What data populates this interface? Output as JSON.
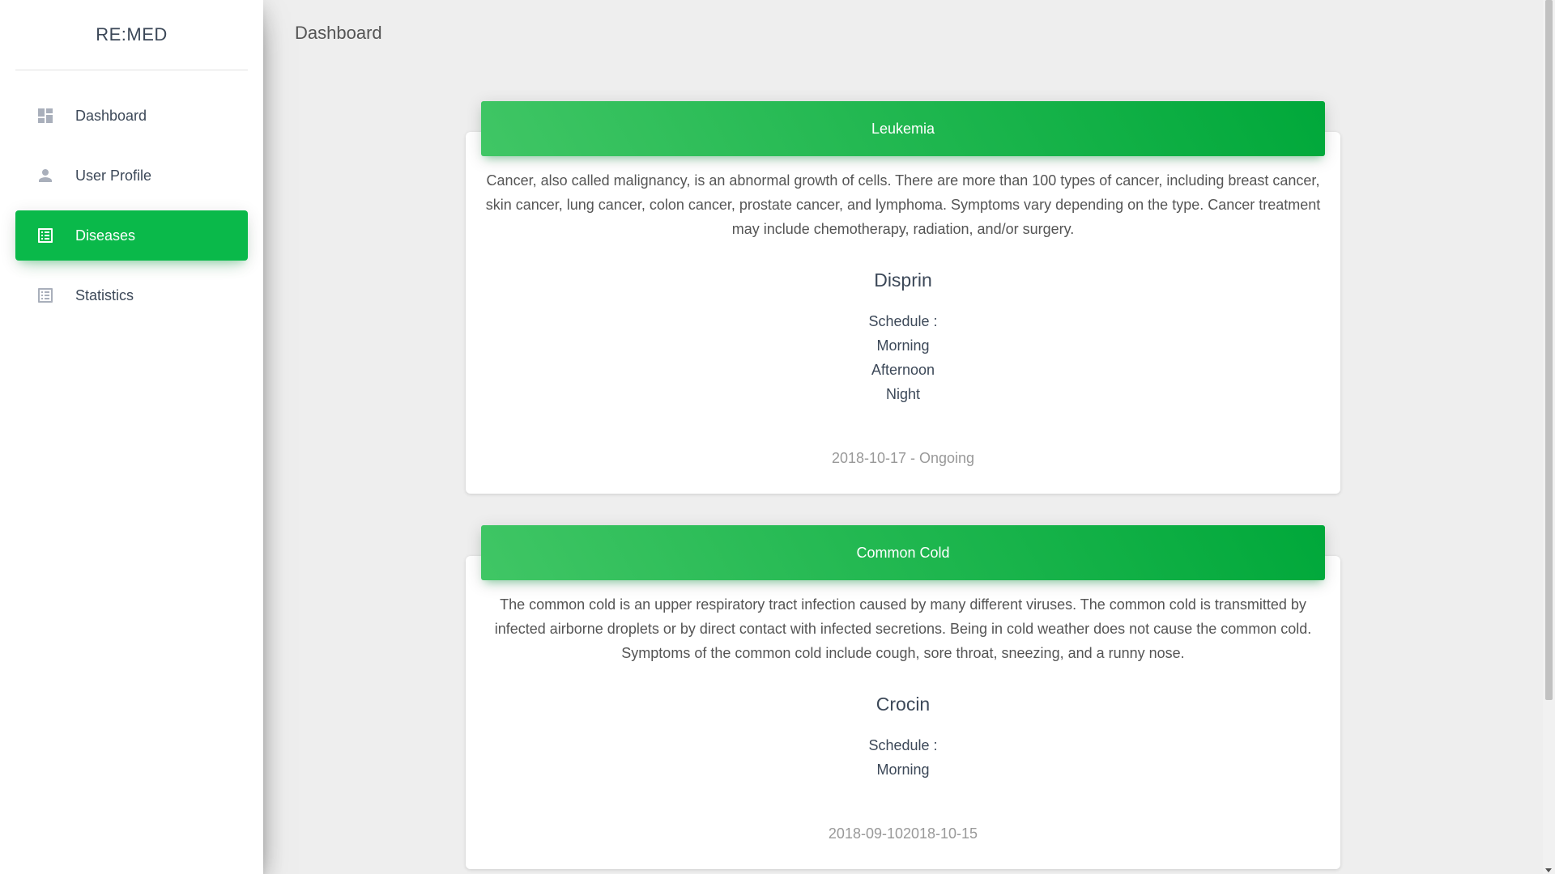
{
  "app": {
    "logo": "RE:MED"
  },
  "sidebar": {
    "items": [
      {
        "label": "Dashboard",
        "icon": "dashboard-icon",
        "active": false
      },
      {
        "label": "User Profile",
        "icon": "person-icon",
        "active": false
      },
      {
        "label": "Diseases",
        "icon": "list-icon",
        "active": true
      },
      {
        "label": "Statistics",
        "icon": "list-icon",
        "active": false
      }
    ]
  },
  "header": {
    "title": "Dashboard"
  },
  "colors": {
    "accent": "#0ab94a",
    "header_gradient_start": "#40c665",
    "header_gradient_end": "#00a83a"
  },
  "diseases": [
    {
      "name": "Leukemia",
      "description": "Cancer, also called malignancy, is an abnormal growth of cells. There are more than 100 types of cancer, including breast cancer, skin cancer, lung cancer, colon cancer, prostate cancer, and lymphoma. Symptoms vary depending on the type. Cancer treatment may include chemotherapy, radiation, and/or surgery.",
      "medicine": "Disprin",
      "schedule_label": "Schedule :",
      "schedule": [
        "Morning",
        "Afternoon",
        "Night"
      ],
      "date_range": "2018-10-17 - Ongoing"
    },
    {
      "name": "Common Cold",
      "description": "The common cold is an upper respiratory tract infection caused by many different viruses. The common cold is transmitted by infected airborne droplets or by direct contact with infected secretions. Being in cold weather does not cause the common cold. Symptoms of the common cold include cough, sore throat, sneezing, and a runny nose.",
      "medicine": "Crocin",
      "schedule_label": "Schedule :",
      "schedule": [
        "Morning"
      ],
      "date_range": "2018-09-102018-10-15"
    }
  ]
}
